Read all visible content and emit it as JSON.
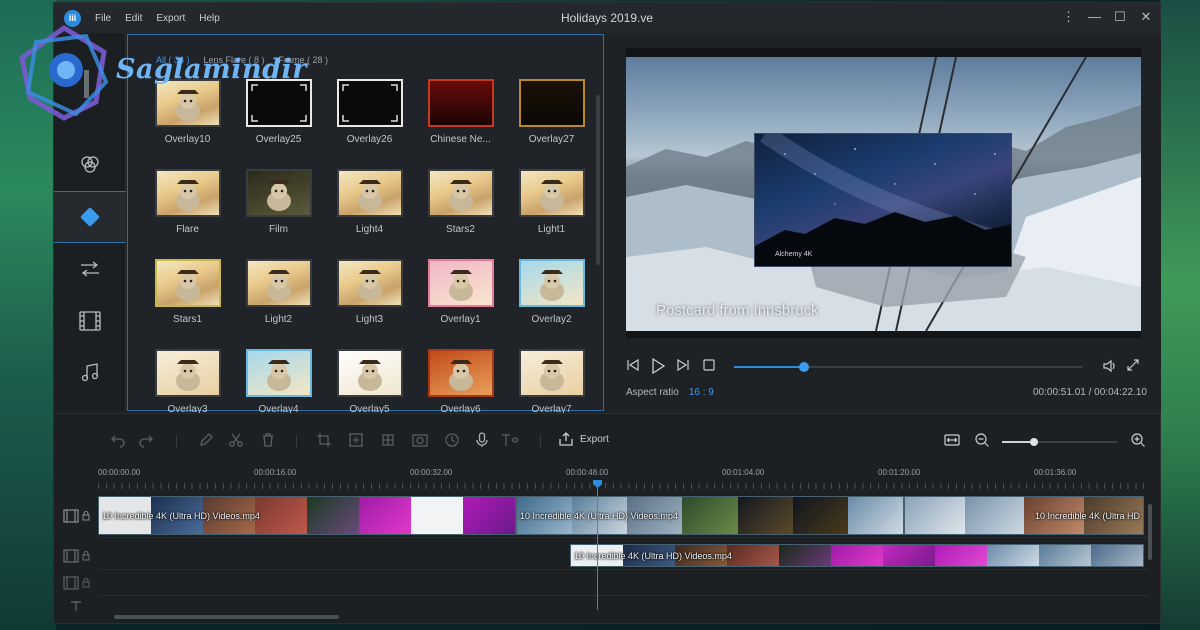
{
  "watermark": {
    "text": "Saglamindir"
  },
  "app": {
    "title": "Holidays 2019.ve",
    "logo_text": "iii",
    "menu": [
      "File",
      "Edit",
      "Export",
      "Help"
    ],
    "window_controls": [
      "more-vert-icon",
      "minimize-icon",
      "maximize-icon",
      "close-icon"
    ]
  },
  "leftnav": {
    "items": [
      {
        "name": "filter-icon",
        "active": false
      },
      {
        "name": "overlay-icon",
        "active": true
      },
      {
        "name": "transition-icon",
        "active": false
      },
      {
        "name": "film-icon",
        "active": false
      },
      {
        "name": "music-icon",
        "active": false
      }
    ]
  },
  "media": {
    "tabs": [
      "All ( 36 )",
      "Lens Flare ( 8 )",
      "Frame ( 28 )"
    ],
    "active_tab": 0,
    "items": [
      {
        "label": "Overlay10",
        "style": "dog"
      },
      {
        "label": "Overlay25",
        "style": "blackframe"
      },
      {
        "label": "Overlay26",
        "style": "blackframe"
      },
      {
        "label": "Chinese Ne...",
        "style": "chinese"
      },
      {
        "label": "Overlay27",
        "style": "goldframe"
      },
      {
        "label": "Flare",
        "style": "dog"
      },
      {
        "label": "Film",
        "style": "film"
      },
      {
        "label": "Light4",
        "style": "dog"
      },
      {
        "label": "Stars2",
        "style": "dog"
      },
      {
        "label": "Light1",
        "style": "dog"
      },
      {
        "label": "Stars1",
        "style": "dog",
        "selected": true
      },
      {
        "label": "Light2",
        "style": "dog"
      },
      {
        "label": "Light3",
        "style": "dog"
      },
      {
        "label": "Overlay1",
        "style": "pinkframe"
      },
      {
        "label": "Overlay2",
        "style": "blueframe"
      },
      {
        "label": "Overlay3",
        "style": "cream"
      },
      {
        "label": "Overlay4",
        "style": "blueframe"
      },
      {
        "label": "Overlay5",
        "style": "white"
      },
      {
        "label": "Overlay6",
        "style": "orange"
      },
      {
        "label": "Overlay7",
        "style": "cream"
      }
    ]
  },
  "preview": {
    "pip_caption": "Alchemy 4K",
    "caption": "Postcard from Innsbruck",
    "aspect_label": "Aspect ratio",
    "aspect_value": "16 : 9",
    "timecode": "00:00:51.01 / 00:04:22.10",
    "progress": 0.2
  },
  "timeline": {
    "toolbar": {
      "export_label": "Export",
      "zoom": 0.28
    },
    "ruler": [
      "00:00:00.00",
      "00:00:16.00",
      "00:00:32.00",
      "00:00:48.00",
      "00:01:04.00",
      "00:01:20.00",
      "00:01:36.00"
    ],
    "clips": [
      {
        "label": "10 Incredible 4K (Ultra HD) Videos.mp4"
      },
      {
        "label": "10 Incredible 4K (Ultra HD) Videos.mp4"
      },
      {
        "label": "10 Incredible 4K (Ultra HD"
      },
      {
        "label": "10 Incredible 4K (Ultra HD) Videos.mp4"
      }
    ]
  },
  "colors": {
    "accent": "#2a8ce0",
    "panel_border": "#2f6fa8",
    "selected_thumb": "#c9b84a"
  }
}
